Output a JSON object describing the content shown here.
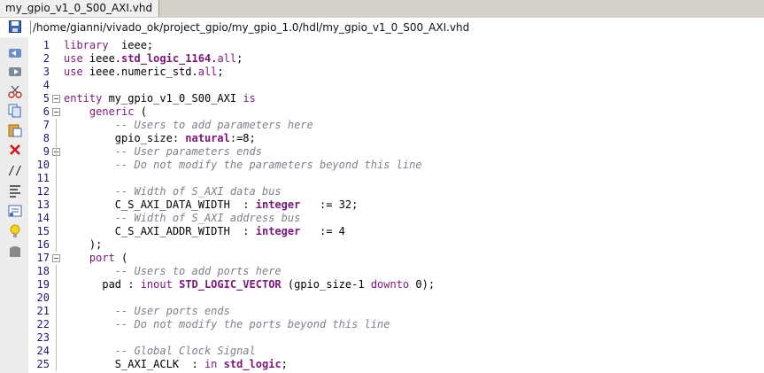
{
  "tab": {
    "title": "my_gpio_v1_0_S00_AXI.vhd *"
  },
  "path": {
    "text": "/home/gianni/vivado_ok/project_gpio/my_gpio_1.0/hdl/my_gpio_v1_0_S00_AXI.vhd"
  },
  "toolbar": {
    "comment": "//"
  },
  "colors": {
    "keyword": "#7a177a",
    "comment": "#7f7f8f",
    "line_number": "#1a1a7a"
  },
  "lines": [
    {
      "n": "1",
      "segs": [
        [
          "kw",
          "library"
        ],
        [
          "",
          "  ieee;"
        ]
      ]
    },
    {
      "n": "2",
      "segs": [
        [
          "kw",
          "use"
        ],
        [
          "",
          " ieee."
        ],
        [
          "ty",
          "std_logic_1164"
        ],
        [
          "",
          "."
        ],
        [
          "kw",
          "all"
        ],
        [
          "",
          ";"
        ]
      ]
    },
    {
      "n": "3",
      "segs": [
        [
          "kw",
          "use"
        ],
        [
          "",
          " ieee.numeric_std."
        ],
        [
          "kw",
          "all"
        ],
        [
          "",
          ";"
        ]
      ]
    },
    {
      "n": "4",
      "segs": []
    },
    {
      "n": "5",
      "segs": [
        [
          "kw",
          "entity"
        ],
        [
          "",
          " my_gpio_v1_0_S00_AXI "
        ],
        [
          "kw",
          "is"
        ]
      ]
    },
    {
      "n": "6",
      "segs": [
        [
          "",
          "    "
        ],
        [
          "kw",
          "generic"
        ],
        [
          "",
          " ("
        ]
      ]
    },
    {
      "n": "7",
      "segs": [
        [
          "",
          "        "
        ],
        [
          "cm",
          "-- Users to add parameters here"
        ]
      ]
    },
    {
      "n": "8",
      "segs": [
        [
          "",
          "        gpio_size: "
        ],
        [
          "ty",
          "natural"
        ],
        [
          "",
          ":=8;"
        ]
      ]
    },
    {
      "n": "9",
      "segs": [
        [
          "",
          "        "
        ],
        [
          "cm",
          "-- User parameters ends"
        ]
      ]
    },
    {
      "n": "10",
      "segs": [
        [
          "",
          "        "
        ],
        [
          "cm",
          "-- Do not modify the parameters beyond this line"
        ]
      ]
    },
    {
      "n": "11",
      "segs": []
    },
    {
      "n": "12",
      "segs": [
        [
          "",
          "        "
        ],
        [
          "cm",
          "-- Width of S_AXI data bus"
        ]
      ]
    },
    {
      "n": "13",
      "segs": [
        [
          "",
          "        C_S_AXI_DATA_WIDTH  : "
        ],
        [
          "ty",
          "integer"
        ],
        [
          "",
          "   := 32;"
        ]
      ]
    },
    {
      "n": "14",
      "segs": [
        [
          "",
          "        "
        ],
        [
          "cm",
          "-- Width of S_AXI address bus"
        ]
      ]
    },
    {
      "n": "15",
      "segs": [
        [
          "",
          "        C_S_AXI_ADDR_WIDTH  : "
        ],
        [
          "ty",
          "integer"
        ],
        [
          "",
          "   := 4"
        ]
      ]
    },
    {
      "n": "16",
      "segs": [
        [
          "",
          "    );"
        ]
      ]
    },
    {
      "n": "17",
      "segs": [
        [
          "",
          "    "
        ],
        [
          "kw",
          "port"
        ],
        [
          "",
          " ("
        ]
      ]
    },
    {
      "n": "18",
      "segs": [
        [
          "",
          "        "
        ],
        [
          "cm",
          "-- Users to add ports here"
        ]
      ]
    },
    {
      "n": "19",
      "segs": [
        [
          "",
          "      pad : "
        ],
        [
          "kw",
          "inout"
        ],
        [
          "",
          " "
        ],
        [
          "ty",
          "STD_LOGIC_VECTOR"
        ],
        [
          "",
          " (gpio_size-1 "
        ],
        [
          "kw",
          "downto"
        ],
        [
          "",
          " 0);"
        ]
      ]
    },
    {
      "n": "20",
      "segs": []
    },
    {
      "n": "21",
      "segs": [
        [
          "",
          "        "
        ],
        [
          "cm",
          "-- User ports ends"
        ]
      ]
    },
    {
      "n": "22",
      "segs": [
        [
          "",
          "        "
        ],
        [
          "cm",
          "-- Do not modify the ports beyond this line"
        ]
      ]
    },
    {
      "n": "23",
      "segs": []
    },
    {
      "n": "24",
      "segs": [
        [
          "",
          "        "
        ],
        [
          "cm",
          "-- Global Clock Signal"
        ]
      ]
    },
    {
      "n": "25",
      "segs": [
        [
          "",
          "        S_AXI_ACLK  : "
        ],
        [
          "kw",
          "in"
        ],
        [
          "",
          " "
        ],
        [
          "ty",
          "std_logic"
        ],
        [
          "",
          ";"
        ]
      ]
    }
  ]
}
